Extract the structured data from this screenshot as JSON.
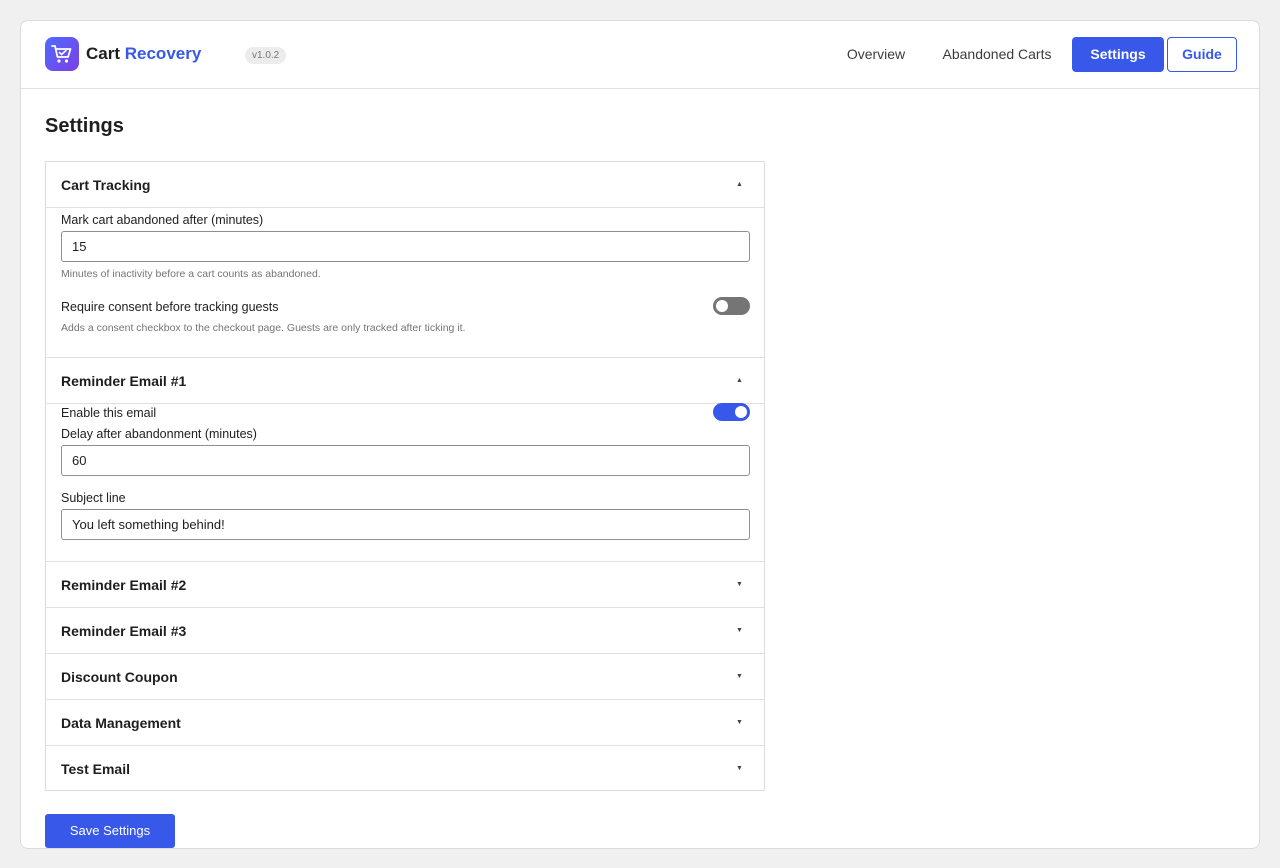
{
  "header": {
    "brand_part1": "Cart",
    "brand_part2": "Recovery",
    "version": "v1.0.2",
    "logo_icon": "cart-icon",
    "nav": {
      "overview": "Overview",
      "abandoned_carts": "Abandoned Carts",
      "settings": "Settings",
      "guide": "Guide"
    }
  },
  "page_title": "Settings",
  "sections": {
    "cart_tracking": {
      "title": "Cart Tracking",
      "expanded": true,
      "abandon_label": "Mark cart abandoned after (minutes)",
      "abandon_value": "15",
      "abandon_help": "Minutes of inactivity before a cart counts as abandoned.",
      "consent_label": "Require consent before tracking guests",
      "consent_enabled": false,
      "consent_help": "Adds a consent checkbox to the checkout page. Guests are only tracked after ticking it."
    },
    "reminder1": {
      "title": "Reminder Email #1",
      "expanded": true,
      "enable_label": "Enable this email",
      "enabled": true,
      "delay_label": "Delay after abandonment (minutes)",
      "delay_value": "60",
      "subject_label": "Subject line",
      "subject_value": "You left something behind!"
    },
    "reminder2": {
      "title": "Reminder Email #2",
      "expanded": false
    },
    "reminder3": {
      "title": "Reminder Email #3",
      "expanded": false
    },
    "discount": {
      "title": "Discount Coupon",
      "expanded": false
    },
    "data_management": {
      "title": "Data Management",
      "expanded": false
    },
    "test_email": {
      "title": "Test Email",
      "expanded": false
    }
  },
  "save_label": "Save Settings",
  "colors": {
    "accent": "#3858e9",
    "toggle_off": "#757575"
  }
}
